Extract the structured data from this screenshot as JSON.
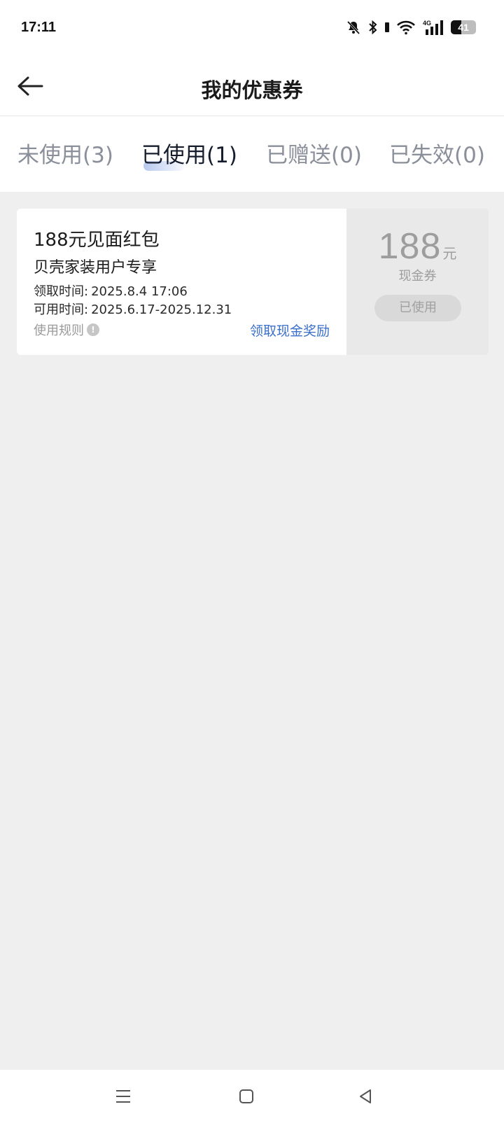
{
  "status_bar": {
    "time": "17:11",
    "icons": [
      "mute-bell-icon",
      "bluetooth-icon",
      "wifi-icon",
      "4g-signal-icon",
      "battery-icon"
    ],
    "network_label": "4G",
    "battery_level": "41",
    "battery_fraction": 0.41
  },
  "header": {
    "back_icon": "arrow-left-icon",
    "title": "我的优惠券"
  },
  "tabs": [
    {
      "label": "未使用(3)",
      "active": false
    },
    {
      "label": "已使用(1)",
      "active": true
    },
    {
      "label": "已赠送(0)",
      "active": false
    },
    {
      "label": "已失效(0)",
      "active": false
    }
  ],
  "coupons": [
    {
      "name": "188元见面红包",
      "scope": "贝壳家装用户专享",
      "claim_time_label": "领取时间:",
      "claim_time": "2025.8.4 17:06",
      "valid_time_label": "可用时间:",
      "valid_time": "2025.6.17-2025.12.31",
      "rules_label": "使用规则",
      "rules_icon": "info-icon",
      "action_label": "领取现金奖励",
      "amount": "188",
      "unit": "元",
      "type": "现金券",
      "status": "已使用"
    }
  ],
  "system_nav": {
    "icons": [
      "menu-icon",
      "home-icon",
      "back-triangle-icon"
    ]
  },
  "colors": {
    "accent_link": "#3b6fc9",
    "page_background": "#efefef",
    "tab_active": "#151c2c",
    "tab_inactive": "#8a8f99"
  }
}
